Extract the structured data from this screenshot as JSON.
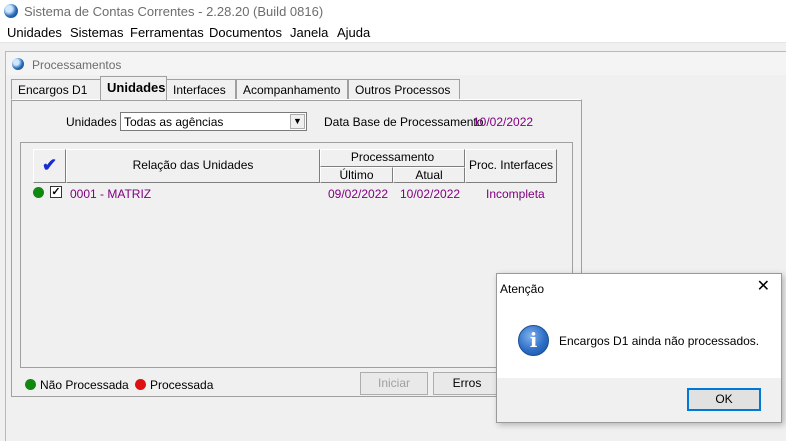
{
  "window": {
    "title": "Sistema de Contas Correntes - 2.28.20 (Build 0816)"
  },
  "menu": [
    "Unidades",
    "Sistemas",
    "Ferramentas",
    "Documentos",
    "Janela",
    "Ajuda"
  ],
  "child_window": {
    "title": "Processamentos"
  },
  "tabs": [
    "Encargos D1",
    "Unidades",
    "Interfaces",
    "Acompanhamento",
    "Outros Processos"
  ],
  "active_tab": "Unidades",
  "filter": {
    "unidades_label": "Unidades",
    "unidades_value": "Todas as agências",
    "data_base_label": "Data Base de Processamento",
    "data_base_value": "10/02/2022"
  },
  "grid": {
    "headers": {
      "relacao": "Relação das Unidades",
      "processamento": "Processamento",
      "ultimo": "Último",
      "atual": "Atual",
      "proc_interfaces": "Proc. Interfaces"
    },
    "rows": [
      {
        "unidade": "0001 - MATRIZ",
        "ultimo": "09/02/2022",
        "atual": "10/02/2022",
        "interfaces": "Incompleta",
        "status": "Não Processada",
        "checked": true
      }
    ]
  },
  "legend": {
    "nao_processada": "Não Processada",
    "processada": "Processada"
  },
  "buttons": {
    "iniciar": "Iniciar",
    "erros": "Erros"
  },
  "dialog": {
    "title": "Atenção",
    "message": "Encargos D1 ainda não processados.",
    "ok": "OK",
    "icon": "info-icon"
  },
  "colors": {
    "purple_text": "#800080",
    "green_status": "#0f8a0f",
    "red_status": "#e01010"
  }
}
